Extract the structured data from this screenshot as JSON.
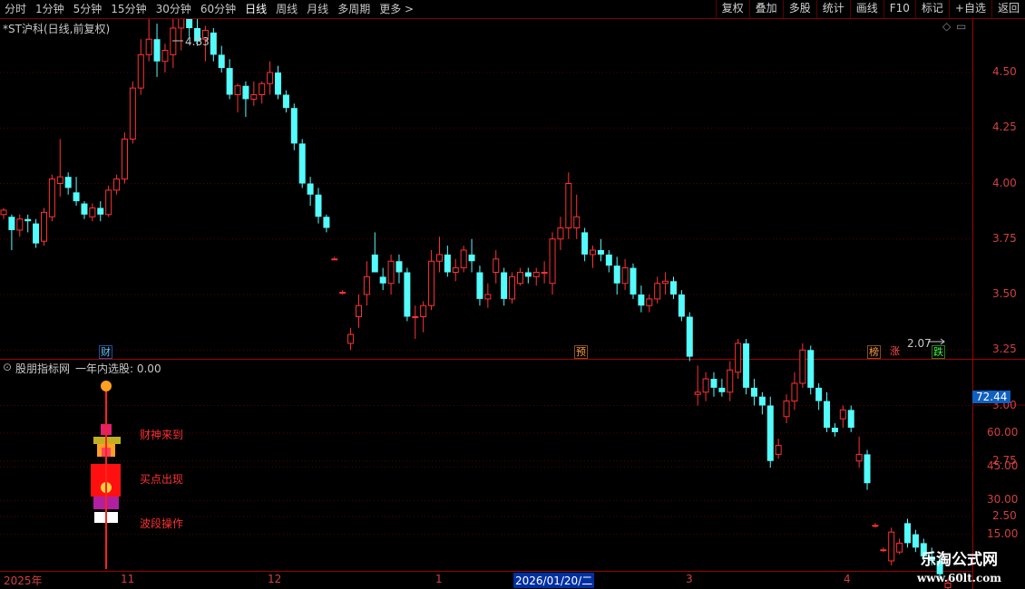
{
  "toolbar": {
    "left_items": [
      "分时",
      "1分钟",
      "5分钟",
      "15分钟",
      "30分钟",
      "60分钟",
      "日线",
      "周线",
      "月线",
      "多周期",
      "更多 >"
    ],
    "active_item": "日线",
    "right_items": [
      "复权",
      "叠加",
      "多股",
      "统计",
      "画线",
      "F10",
      "标记",
      "+自选",
      "返回"
    ]
  },
  "main_chart": {
    "title": "*ST沪科(日线,前复权)",
    "y_axis_labels": [
      "4.50",
      "4.25",
      "4.00",
      "3.75",
      "3.50",
      "3.25",
      "3.00",
      "2.75",
      "2.50"
    ],
    "high_label": "4.83",
    "low_label": "2.07",
    "markers": [
      {
        "text": "财",
        "color": "#5cc8ff"
      },
      {
        "text": "预",
        "color": "#ffa040"
      },
      {
        "text": "榜",
        "color": "#ffa040"
      },
      {
        "text": "涨",
        "color": "#ff5050"
      },
      {
        "text": "跌",
        "color": "#40ff40"
      }
    ]
  },
  "indicator": {
    "title": "股朋指标网",
    "subtitle": "一年内选股: 0.00",
    "current_value": "72.44",
    "y_axis_labels": [
      "60.00",
      "45.00",
      "30.00",
      "15.00"
    ],
    "texts": [
      "财神来到",
      "买点出现",
      "波段操作"
    ]
  },
  "date_axis": {
    "labels": [
      "2025年",
      "11",
      "12",
      "1",
      "3",
      "4"
    ],
    "cursor_date": "2026/01/20/二"
  },
  "watermark": {
    "line1": "乐淘公式网",
    "line2": "www.60lt.com"
  },
  "colors": {
    "up": "#ff3232",
    "down": "#54fcfc",
    "grid": "#800000",
    "yellow": "#ffff00"
  },
  "chart_data": {
    "type": "candlestick",
    "series": [
      {
        "values": [
          [
            3.86,
            3.89,
            3.84,
            3.88
          ],
          [
            3.85,
            3.86,
            3.7,
            3.79
          ],
          [
            3.79,
            3.86,
            3.76,
            3.84
          ],
          [
            3.84,
            3.86,
            3.78,
            3.83
          ],
          [
            3.82,
            3.84,
            3.71,
            3.73
          ],
          [
            3.74,
            3.89,
            3.72,
            3.87
          ],
          [
            3.85,
            4.04,
            3.83,
            4.02
          ],
          [
            4.0,
            4.2,
            3.94,
            4.03
          ],
          [
            4.03,
            4.05,
            3.95,
            3.98
          ],
          [
            3.96,
            4.03,
            3.9,
            3.92
          ],
          [
            3.91,
            3.92,
            3.84,
            3.86
          ],
          [
            3.85,
            3.91,
            3.83,
            3.89
          ],
          [
            3.89,
            3.92,
            3.83,
            3.86
          ],
          [
            3.86,
            3.99,
            3.85,
            3.97
          ],
          [
            3.97,
            4.04,
            3.95,
            4.02
          ],
          [
            4.02,
            4.23,
            4.0,
            4.2
          ],
          [
            4.2,
            4.46,
            4.18,
            4.43
          ],
          [
            4.43,
            4.65,
            4.4,
            4.58
          ],
          [
            4.58,
            4.8,
            4.55,
            4.65
          ],
          [
            4.65,
            4.72,
            4.48,
            4.55
          ],
          [
            4.55,
            4.63,
            4.5,
            4.6
          ],
          [
            4.58,
            4.75,
            4.52,
            4.7
          ],
          [
            4.7,
            4.83,
            4.6,
            4.8
          ],
          [
            4.8,
            4.82,
            4.66,
            4.7
          ],
          [
            4.7,
            4.75,
            4.62,
            4.64
          ],
          [
            4.65,
            4.71,
            4.55,
            4.69
          ],
          [
            4.68,
            4.7,
            4.55,
            4.58
          ],
          [
            4.58,
            4.62,
            4.5,
            4.52
          ],
          [
            4.52,
            4.56,
            4.38,
            4.4
          ],
          [
            4.4,
            4.45,
            4.32,
            4.44
          ],
          [
            4.44,
            4.46,
            4.3,
            4.38
          ],
          [
            4.38,
            4.46,
            4.35,
            4.4
          ],
          [
            4.4,
            4.46,
            4.36,
            4.45
          ],
          [
            4.45,
            4.55,
            4.4,
            4.5
          ],
          [
            4.5,
            4.53,
            4.38,
            4.4
          ],
          [
            4.4,
            4.42,
            4.32,
            4.34
          ],
          [
            4.34,
            4.36,
            4.15,
            4.18
          ],
          [
            4.18,
            4.2,
            3.98,
            4.0
          ],
          [
            4.0,
            4.03,
            3.9,
            3.95
          ],
          [
            3.95,
            3.98,
            3.82,
            3.85
          ],
          [
            3.85,
            3.86,
            3.78,
            3.8
          ],
          [
            3.66,
            3.67,
            3.66,
            3.66
          ],
          [
            3.51,
            3.52,
            3.5,
            3.51
          ],
          [
            3.28,
            3.35,
            3.25,
            3.32
          ],
          [
            3.4,
            3.5,
            3.35,
            3.45
          ],
          [
            3.5,
            3.65,
            3.45,
            3.58
          ],
          [
            3.68,
            3.78,
            3.6,
            3.6
          ],
          [
            3.58,
            3.62,
            3.52,
            3.55
          ],
          [
            3.55,
            3.68,
            3.5,
            3.65
          ],
          [
            3.65,
            3.68,
            3.55,
            3.6
          ],
          [
            3.6,
            3.62,
            3.38,
            3.4
          ],
          [
            3.4,
            3.45,
            3.3,
            3.4
          ],
          [
            3.4,
            3.47,
            3.33,
            3.45
          ],
          [
            3.45,
            3.7,
            3.43,
            3.65
          ],
          [
            3.65,
            3.76,
            3.6,
            3.68
          ],
          [
            3.68,
            3.72,
            3.58,
            3.6
          ],
          [
            3.6,
            3.66,
            3.56,
            3.62
          ],
          [
            3.62,
            3.72,
            3.6,
            3.7
          ],
          [
            3.68,
            3.75,
            3.6,
            3.65
          ],
          [
            3.6,
            3.63,
            3.45,
            3.48
          ],
          [
            3.48,
            3.55,
            3.44,
            3.5
          ],
          [
            3.6,
            3.7,
            3.55,
            3.66
          ],
          [
            3.6,
            3.62,
            3.45,
            3.48
          ],
          [
            3.48,
            3.6,
            3.46,
            3.58
          ],
          [
            3.55,
            3.62,
            3.54,
            3.6
          ],
          [
            3.6,
            3.62,
            3.55,
            3.58
          ],
          [
            3.58,
            3.62,
            3.54,
            3.6
          ],
          [
            3.6,
            3.65,
            3.55,
            3.6
          ],
          [
            3.55,
            3.78,
            3.5,
            3.75
          ],
          [
            3.75,
            3.85,
            3.7,
            3.8
          ],
          [
            3.8,
            4.05,
            3.75,
            4.0
          ],
          [
            3.8,
            3.95,
            3.75,
            3.85
          ],
          [
            3.78,
            3.8,
            3.65,
            3.68
          ],
          [
            3.68,
            3.72,
            3.62,
            3.7
          ],
          [
            3.7,
            3.75,
            3.65,
            3.68
          ],
          [
            3.68,
            3.7,
            3.6,
            3.63
          ],
          [
            3.63,
            3.67,
            3.5,
            3.55
          ],
          [
            3.55,
            3.66,
            3.52,
            3.62
          ],
          [
            3.62,
            3.64,
            3.48,
            3.5
          ],
          [
            3.5,
            3.54,
            3.42,
            3.45
          ],
          [
            3.45,
            3.5,
            3.42,
            3.48
          ],
          [
            3.48,
            3.58,
            3.46,
            3.55
          ],
          [
            3.55,
            3.6,
            3.5,
            3.56
          ],
          [
            3.56,
            3.58,
            3.48,
            3.5
          ],
          [
            3.5,
            3.52,
            3.38,
            3.4
          ],
          [
            3.4,
            3.42,
            3.2,
            3.22
          ],
          [
            3.05,
            3.18,
            3.0,
            3.06
          ],
          [
            3.06,
            3.15,
            3.02,
            3.12
          ],
          [
            3.12,
            3.15,
            3.04,
            3.08
          ],
          [
            3.08,
            3.12,
            3.04,
            3.06
          ],
          [
            3.06,
            3.2,
            3.02,
            3.16
          ],
          [
            3.15,
            3.3,
            3.12,
            3.28
          ],
          [
            3.28,
            3.3,
            3.05,
            3.08
          ],
          [
            3.08,
            3.12,
            3.0,
            3.04
          ],
          [
            3.04,
            3.06,
            2.96,
            3.0
          ],
          [
            3.0,
            3.04,
            2.72,
            2.75
          ],
          [
            2.78,
            2.85,
            2.76,
            2.82
          ],
          [
            2.95,
            3.05,
            2.92,
            3.02
          ],
          [
            3.02,
            3.15,
            2.98,
            3.1
          ],
          [
            3.1,
            3.28,
            3.08,
            3.25
          ],
          [
            3.25,
            3.27,
            3.05,
            3.08
          ],
          [
            3.08,
            3.1,
            2.98,
            3.02
          ],
          [
            3.02,
            3.06,
            2.88,
            2.9
          ],
          [
            2.9,
            2.92,
            2.86,
            2.88
          ],
          [
            2.94,
            3.0,
            2.9,
            2.98
          ],
          [
            2.98,
            3.0,
            2.88,
            2.9
          ],
          [
            2.75,
            2.86,
            2.72,
            2.78
          ],
          [
            2.78,
            2.8,
            2.62,
            2.65
          ],
          [
            2.46,
            2.47,
            2.45,
            2.46
          ],
          [
            2.35,
            2.36,
            2.34,
            2.35
          ],
          [
            2.3,
            2.45,
            2.28,
            2.43
          ],
          [
            2.34,
            2.4,
            2.33,
            2.38
          ],
          [
            2.47,
            2.49,
            2.36,
            2.38
          ],
          [
            2.42,
            2.44,
            2.34,
            2.36
          ],
          [
            2.38,
            2.4,
            2.3,
            2.32
          ],
          [
            2.32,
            2.36,
            2.28,
            2.3
          ],
          [
            2.3,
            2.32,
            2.22,
            2.24
          ],
          [
            2.18,
            2.22,
            2.1,
            2.2
          ]
        ]
      }
    ]
  }
}
